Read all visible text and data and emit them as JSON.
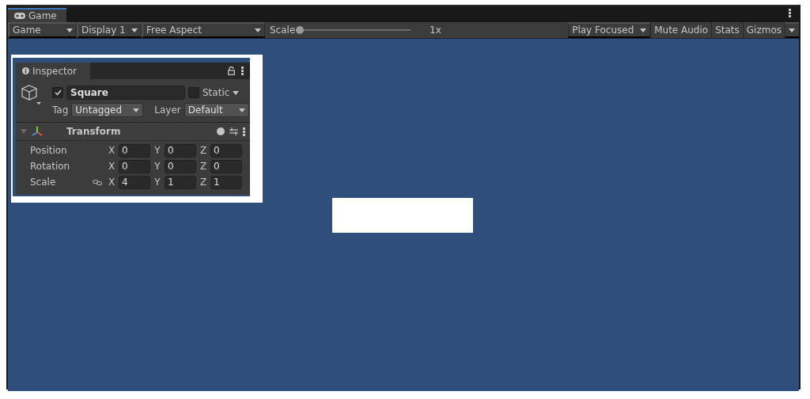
{
  "window": {
    "tab": {
      "label": "Game",
      "selected": true
    }
  },
  "toolbar": {
    "dropdowns": [
      {
        "label": "Game"
      },
      {
        "label": "Display 1"
      },
      {
        "label": "Free Aspect"
      }
    ],
    "scale": {
      "label": "Scale",
      "level": 0,
      "reading": "1x"
    },
    "play_mode": {
      "label": "Play Focused"
    },
    "toggles": [
      {
        "label": "Mute Audio",
        "on": false
      },
      {
        "label": "Stats",
        "on": false
      }
    ],
    "gizmos": {
      "label": "Gizmos",
      "on": false
    }
  },
  "inspector": {
    "tab": {
      "label": "Inspector",
      "selected": true
    },
    "object": {
      "active": true,
      "name": "Square",
      "static": false,
      "static_label": "Static",
      "tag_label": "Tag",
      "tag": "Untagged",
      "layer_label": "Layer",
      "layer": "Default"
    },
    "component": {
      "title": "Transform",
      "expanded": true,
      "rows": [
        {
          "label": "Position",
          "constrain_icon": false,
          "axes": [
            {
              "axis": "X",
              "value": "0"
            },
            {
              "axis": "Y",
              "value": "0"
            },
            {
              "axis": "Z",
              "value": "0"
            }
          ]
        },
        {
          "label": "Rotation",
          "constrain_icon": false,
          "axes": [
            {
              "axis": "X",
              "value": "0"
            },
            {
              "axis": "Y",
              "value": "0"
            },
            {
              "axis": "Z",
              "value": "0"
            }
          ]
        },
        {
          "label": "Scale",
          "constrain_icon": true,
          "axes": [
            {
              "axis": "X",
              "value": "4"
            },
            {
              "axis": "Y",
              "value": "1"
            },
            {
              "axis": "Z",
              "value": "1"
            }
          ]
        }
      ]
    }
  }
}
